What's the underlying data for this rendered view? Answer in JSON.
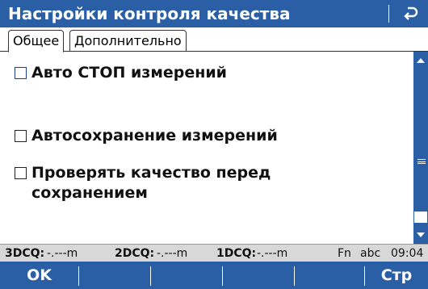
{
  "title_bar": {
    "title": "Настройки контроля качества",
    "back_icon": "return-arrow-icon"
  },
  "tabs": [
    {
      "label": "Общее",
      "active": true
    },
    {
      "label": "Дополнительно",
      "active": false
    }
  ],
  "options": [
    {
      "label": "Авто СТОП измерений",
      "checked": false,
      "focused": true
    },
    {
      "label": "Автосохранение измерений",
      "checked": false,
      "focused": false
    },
    {
      "label_line1": "Проверять качество перед",
      "label_line2": "сохранением",
      "checked": false,
      "focused": false
    }
  ],
  "status_bar": {
    "dcq3_key": "3DCQ:",
    "dcq3_value": "-.---m",
    "dcq2_key": "2DCQ:",
    "dcq2_value": "-.---m",
    "dcq1_key": "1DCQ:",
    "dcq1_value": "-.---m",
    "fn": "Fn",
    "input_mode": "abc",
    "time": "09:04"
  },
  "softkeys": {
    "f1": "OK",
    "f2": "",
    "f3": "",
    "f4": "",
    "f5": "",
    "f6": "Стр"
  },
  "colors": {
    "accent": "#2a5fa6",
    "status_bg": "#d8d8d8"
  }
}
